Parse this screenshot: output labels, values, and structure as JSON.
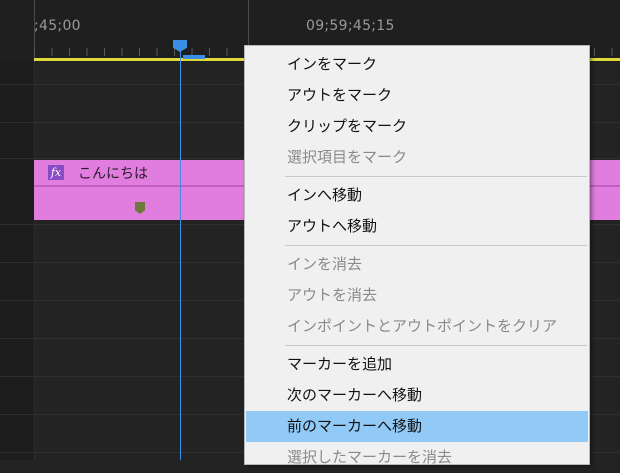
{
  "ruler": {
    "timecodes": [
      ";45;00",
      "09;59;45;15"
    ]
  },
  "clip": {
    "fx_label": "fx",
    "name": "こんにちは"
  },
  "context_menu": {
    "groups": [
      [
        {
          "label": "インをマーク",
          "enabled": true
        },
        {
          "label": "アウトをマーク",
          "enabled": true
        },
        {
          "label": "クリップをマーク",
          "enabled": true
        },
        {
          "label": "選択項目をマーク",
          "enabled": false
        }
      ],
      [
        {
          "label": "インへ移動",
          "enabled": true
        },
        {
          "label": "アウトへ移動",
          "enabled": true
        }
      ],
      [
        {
          "label": "インを消去",
          "enabled": false
        },
        {
          "label": "アウトを消去",
          "enabled": false
        },
        {
          "label": "インポイントとアウトポイントをクリア",
          "enabled": false
        }
      ],
      [
        {
          "label": "マーカーを追加",
          "enabled": true
        },
        {
          "label": "次のマーカーへ移動",
          "enabled": true
        },
        {
          "label": "前のマーカーへ移動",
          "enabled": true,
          "highlighted": true
        },
        {
          "label": "選択したマーカーを消去",
          "enabled": false
        }
      ]
    ]
  },
  "colors": {
    "playhead": "#3a8ee6",
    "work_area": "#e0d93a",
    "clip": "#e07ddf",
    "menu_highlight": "#91c9f7"
  }
}
